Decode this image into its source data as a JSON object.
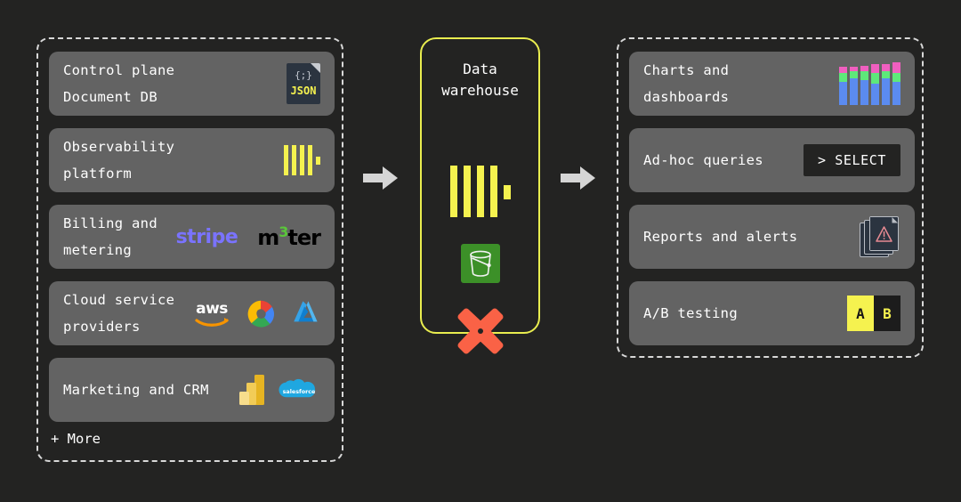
{
  "diagram": {
    "background_color": "#232322",
    "accent_color": "#e9ed4f",
    "card_color": "#636363",
    "groups": {
      "sources": {
        "name": "data-sources",
        "more_label": "+ More",
        "cards": [
          {
            "label": "Control plane\nDocument DB",
            "icons": [
              "json-file-icon"
            ]
          },
          {
            "label": "Observability\nplatform",
            "icons": [
              "clickhouse-logo"
            ]
          },
          {
            "label": "Billing and\nmetering",
            "icons": [
              "stripe-logo",
              "m3ter-logo"
            ]
          },
          {
            "label": "Cloud service\nproviders",
            "icons": [
              "aws-logo",
              "google-cloud-logo",
              "azure-logo"
            ]
          },
          {
            "label": "Marketing and CRM",
            "icons": [
              "power-bi-logo",
              "salesforce-logo"
            ]
          }
        ]
      },
      "warehouse": {
        "title": "Data\nwarehouse",
        "icons": [
          "clickhouse-logo",
          "s3-bucket-icon",
          "pinot-logo"
        ]
      },
      "outputs": {
        "name": "data-consumers",
        "cards": [
          {
            "label": "Charts and\ndashboards",
            "icons": [
              "stacked-bar-chart-icon"
            ]
          },
          {
            "label": "Ad-hoc queries",
            "icons": [
              "select-query-badge"
            ],
            "badge_text": "> SELECT"
          },
          {
            "label": "Reports and alerts",
            "icons": [
              "report-alert-icon"
            ]
          },
          {
            "label": "A/B testing",
            "icons": [
              "ab-test-badge"
            ],
            "badge_a": "A",
            "badge_b": "B"
          }
        ]
      }
    },
    "logos": {
      "stripe": "stripe",
      "m3ter_prefix": "m",
      "m3ter_three": "3",
      "m3ter_suffix": "ter",
      "aws": "aws",
      "salesforce": "salesforce",
      "json_brace": "{;}",
      "json_word": "JSON"
    },
    "arrows": [
      "arrow-sources-to-warehouse",
      "arrow-warehouse-to-outputs"
    ]
  },
  "chart_data": {
    "type": "bar",
    "title": "Charts and dashboards icon",
    "categories": [
      "1",
      "2",
      "3",
      "4",
      "5",
      "6"
    ],
    "series": [
      {
        "name": "blue",
        "values": [
          26,
          30,
          28,
          24,
          30,
          26
        ]
      },
      {
        "name": "green",
        "values": [
          10,
          8,
          10,
          12,
          8,
          10
        ]
      },
      {
        "name": "pink",
        "values": [
          7,
          5,
          6,
          10,
          8,
          12
        ]
      }
    ],
    "colors": {
      "blue": "#5b8bf0",
      "green": "#5ee87a",
      "pink": "#f05fc0"
    },
    "xlabel": "",
    "ylabel": "",
    "grid": false,
    "legend": "none"
  }
}
